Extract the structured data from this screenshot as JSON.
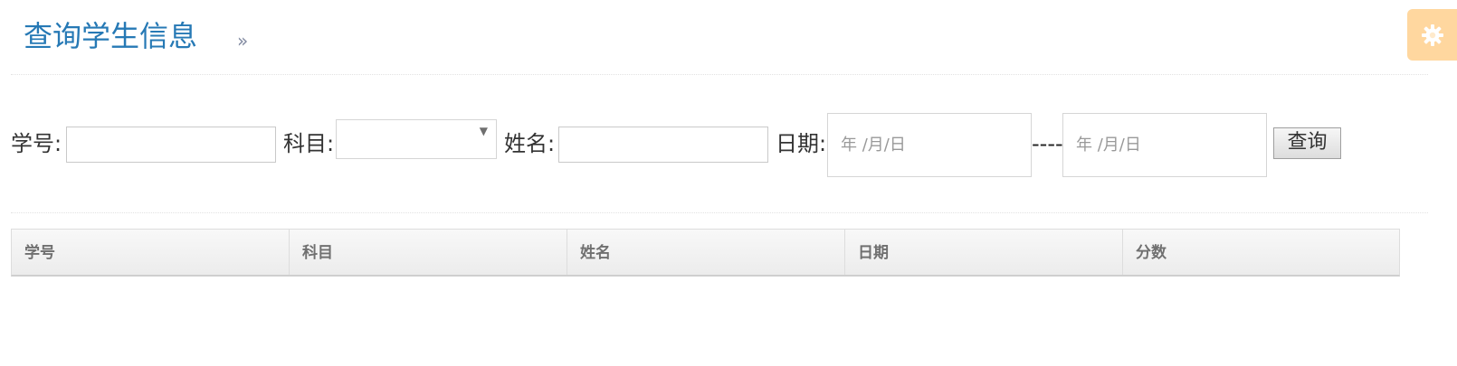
{
  "header": {
    "title": "查询学生信息",
    "chevron": "»"
  },
  "settings": {
    "icon": "gear-icon",
    "color": "#ffb752"
  },
  "search": {
    "student_id_label": "学号:",
    "student_id_value": "",
    "subject_label": "科目:",
    "subject_selected": "",
    "name_label": "姓名:",
    "name_value": "",
    "date_label": "日期:",
    "date_start_placeholder": "年 /月/日",
    "date_separator": "----",
    "date_end_placeholder": "年 /月/日",
    "query_button": "查询"
  },
  "table": {
    "columns": [
      "学号",
      "科目",
      "姓名",
      "日期",
      "分数"
    ],
    "rows": []
  },
  "colors": {
    "title": "#2679b5",
    "settings_bg": "#ffb752"
  }
}
